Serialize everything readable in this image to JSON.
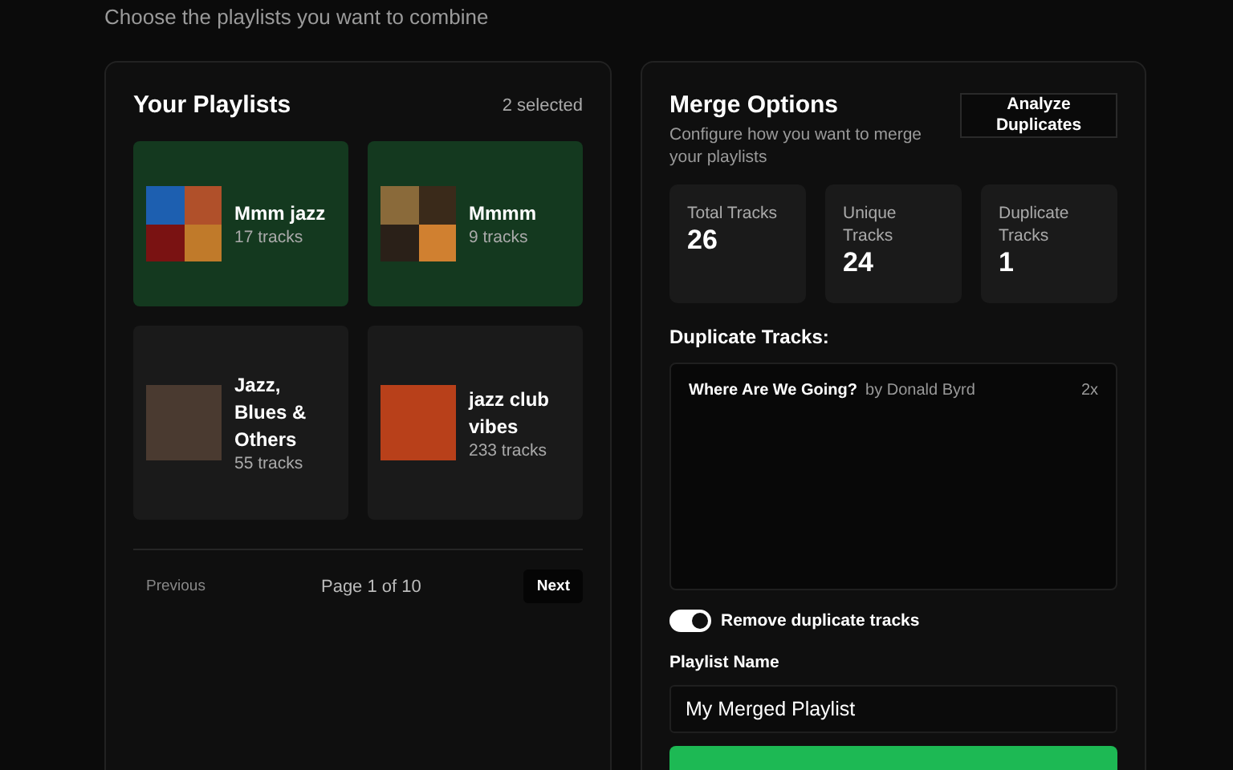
{
  "subtitle": "Choose the playlists you want to combine",
  "playlists_panel": {
    "title": "Your Playlists",
    "selection_count": "2 selected",
    "playlists": [
      {
        "name": "Mmm jazz",
        "tracks": "17 tracks",
        "selected": true,
        "kind": "collage"
      },
      {
        "name": "Mmmm",
        "tracks": "9 tracks",
        "selected": true,
        "kind": "collage"
      },
      {
        "name": "Jazz, Blues & Others",
        "tracks": "55 tracks",
        "selected": false,
        "kind": "single"
      },
      {
        "name": "jazz club vibes",
        "tracks": "233 tracks",
        "selected": false,
        "kind": "single"
      }
    ],
    "pagination": {
      "previous": "Previous",
      "page": "Page 1 of 10",
      "next": "Next",
      "previous_disabled": true
    }
  },
  "merge_panel": {
    "title": "Merge Options",
    "description": "Configure how you want to merge your playlists",
    "analyze_button": "Analyze Duplicates",
    "stats": [
      {
        "label": "Total Tracks",
        "value": "26"
      },
      {
        "label": "Unique Tracks",
        "value": "24"
      },
      {
        "label": "Duplicate Tracks",
        "value": "1"
      }
    ],
    "duplicates_heading": "Duplicate Tracks:",
    "duplicates": [
      {
        "title": "Where Are We Going?",
        "artist": "by Donald Byrd",
        "count": "2x"
      }
    ],
    "remove_duplicates": {
      "label": "Remove duplicate tracks",
      "on": true
    },
    "name_label": "Playlist Name",
    "name_value": "My Merged Playlist"
  }
}
